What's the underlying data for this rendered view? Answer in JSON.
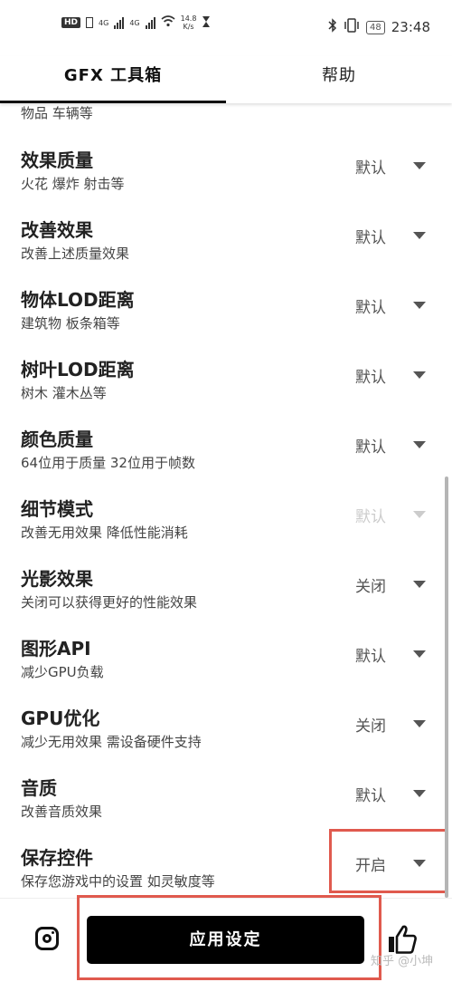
{
  "status_bar": {
    "hd": "HD",
    "net_type_1": "4G",
    "net_type_2": "4G",
    "speed_value": "14.8",
    "speed_unit": "K/s",
    "battery": "48",
    "time": "23:48"
  },
  "tabs": [
    {
      "label": "GFX 工具箱",
      "selected": true
    },
    {
      "label": "帮助",
      "selected": false
    }
  ],
  "partial_text": "物品 车辆等",
  "settings": [
    {
      "title": "效果质量",
      "subtitle": "火花 爆炸 射击等",
      "value": "默认",
      "enabled": true
    },
    {
      "title": "改善效果",
      "subtitle": "改善上述质量效果",
      "value": "默认",
      "enabled": true
    },
    {
      "title": "物体LOD距离",
      "subtitle": "建筑物 板条箱等",
      "value": "默认",
      "enabled": true
    },
    {
      "title": "树叶LOD距离",
      "subtitle": "树木 灌木丛等",
      "value": "默认",
      "enabled": true
    },
    {
      "title": "颜色质量",
      "subtitle": "64位用于质量 32位用于帧数",
      "value": "默认",
      "enabled": true
    },
    {
      "title": "细节模式",
      "subtitle": "改善无用效果 降低性能消耗",
      "value": "默认",
      "enabled": false
    },
    {
      "title": "光影效果",
      "subtitle": "关闭可以获得更好的性能效果",
      "value": "关闭",
      "enabled": true
    },
    {
      "title": "图形API",
      "subtitle": "减少GPU负载",
      "value": "默认",
      "enabled": true
    },
    {
      "title": "GPU优化",
      "subtitle": "减少无用效果 需设备硬件支持",
      "value": "关闭",
      "enabled": true
    },
    {
      "title": "音质",
      "subtitle": "改善音质效果",
      "value": "默认",
      "enabled": true
    },
    {
      "title": "保存控件",
      "subtitle": "保存您游戏中的设置 如灵敏度等",
      "value": "开启",
      "enabled": true
    }
  ],
  "bottom": {
    "apply_label": "应用设定",
    "watermark": "知乎 @小坤"
  },
  "colors": {
    "highlight": "#e05a4e",
    "button_bg": "#000000"
  },
  "icons": [
    "instagram-icon",
    "thumbs-up-icon",
    "dropdown-arrow-icon",
    "bluetooth-icon",
    "vibrate-icon",
    "wifi-icon",
    "hourglass-icon"
  ]
}
